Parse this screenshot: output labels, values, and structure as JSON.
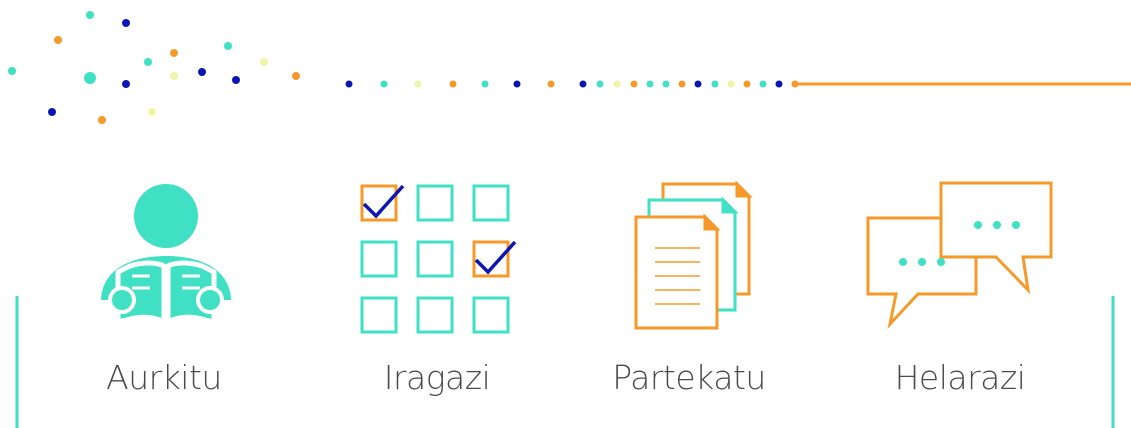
{
  "colors": {
    "teal": "#3fe0c4",
    "orange": "#f59a2a",
    "navy": "#0b16b3",
    "lime": "#eef5a8",
    "text": "#4a4a4a"
  },
  "steps": [
    {
      "label": "Aurkitu",
      "icon": "person-reading-icon"
    },
    {
      "label": "Iragazi",
      "icon": "checkbox-grid-icon"
    },
    {
      "label": "Partekatu",
      "icon": "documents-stack-icon"
    },
    {
      "label": "Helarazi",
      "icon": "speech-bubbles-icon"
    }
  ]
}
